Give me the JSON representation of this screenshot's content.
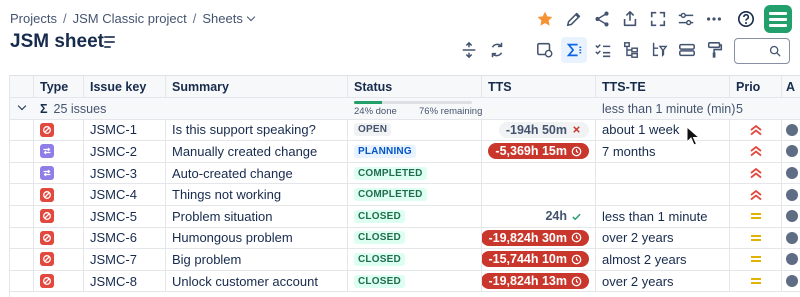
{
  "breadcrumb": {
    "items": [
      "Projects",
      "JSM Classic project",
      "Sheets"
    ],
    "separator": "/"
  },
  "page": {
    "title": "JSM sheet"
  },
  "top_actions": [
    "star-icon",
    "pencil-icon",
    "share-icon",
    "export-icon",
    "fullscreen-icon",
    "settings-sliders-icon",
    "more-icon",
    "help-icon"
  ],
  "toolbar_icons": [
    "row-height-icon",
    "refresh-icon",
    "view-settings-icon",
    "sum-icon",
    "checklist-icon",
    "hierarchy-icon",
    "filter-hierarchy-icon",
    "stack-icon",
    "format-painter-icon"
  ],
  "search": {
    "placeholder": ""
  },
  "columns": [
    "Type",
    "Issue key",
    "Summary",
    "Status",
    "TTS",
    "TTS-TE",
    "Prio",
    "A"
  ],
  "group": {
    "sigma": "Σ",
    "label": "25 issues",
    "done_label": "24% done",
    "remaining_label": "76% remaining",
    "done_fraction": 0.24,
    "tts_te": "less than 1 minute (min)",
    "prio": "5"
  },
  "rows": [
    {
      "type": "incident",
      "key": "JSMC-1",
      "summary": "Is this support speaking?",
      "status": "OPEN",
      "status_style": "open",
      "tts": "-194h 50m",
      "tts_style": "gray",
      "tts_icon": "x",
      "tts_te": "about 1 week",
      "prio": "high"
    },
    {
      "type": "change",
      "key": "JSMC-2",
      "summary": "Manually created change",
      "status": "PLANNING",
      "status_style": "planning",
      "tts": "-5,369h 15m",
      "tts_style": "red",
      "tts_icon": "clock",
      "tts_te": "7 months",
      "prio": "high"
    },
    {
      "type": "change",
      "key": "JSMC-3",
      "summary": "Auto-created change",
      "status": "COMPLETED",
      "status_style": "completed",
      "tts": "",
      "tts_style": "none",
      "tts_icon": "",
      "tts_te": "",
      "prio": "high"
    },
    {
      "type": "incident",
      "key": "JSMC-4",
      "summary": "Things not working",
      "status": "COMPLETED",
      "status_style": "completed",
      "tts": "",
      "tts_style": "none",
      "tts_icon": "",
      "tts_te": "",
      "prio": "high"
    },
    {
      "type": "incident",
      "key": "JSMC-5",
      "summary": "Problem situation",
      "status": "CLOSED",
      "status_style": "closed",
      "tts": "24h",
      "tts_style": "plain",
      "tts_icon": "check",
      "tts_te": "less than 1 minute",
      "prio": "medium"
    },
    {
      "type": "incident",
      "key": "JSMC-6",
      "summary": "Humongous problem",
      "status": "CLOSED",
      "status_style": "closed",
      "tts": "-19,824h 30m",
      "tts_style": "red",
      "tts_icon": "clock",
      "tts_te": "over 2 years",
      "prio": "medium"
    },
    {
      "type": "incident",
      "key": "JSMC-7",
      "summary": "Big problem",
      "status": "CLOSED",
      "status_style": "closed",
      "tts": "-15,744h 10m",
      "tts_style": "red",
      "tts_icon": "clock",
      "tts_te": "almost 2 years",
      "prio": "medium"
    },
    {
      "type": "incident",
      "key": "JSMC-8",
      "summary": "Unlock customer account",
      "status": "CLOSED",
      "status_style": "closed",
      "tts": "-19,824h 13m",
      "tts_style": "red",
      "tts_icon": "clock",
      "tts_te": "over 2 years",
      "prio": "medium"
    }
  ],
  "colors": {
    "incident": "#e2483d",
    "change": "#8f7ee7",
    "accent": "#0c66e4",
    "brand": "#22a06b",
    "prio_high": "#e2483d",
    "prio_medium": "#e2b203",
    "breach_red": "#c9372c"
  }
}
